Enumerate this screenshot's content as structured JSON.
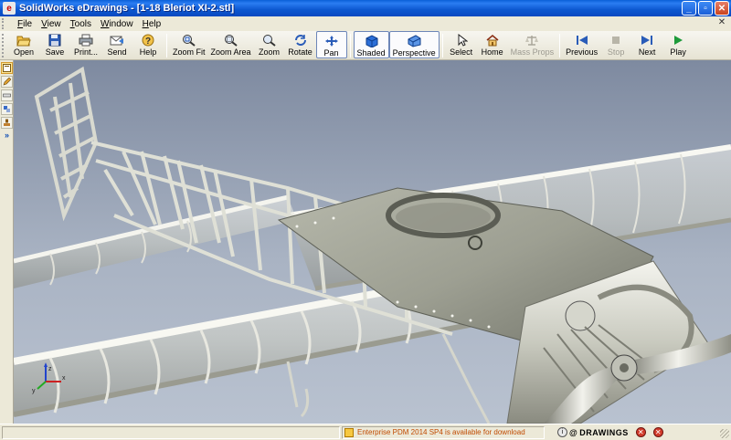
{
  "window": {
    "title": "SolidWorks eDrawings - [1-18 Bleriot XI-2.stl]",
    "app_icon": "edrawings-icon"
  },
  "menu": {
    "items": [
      "File",
      "View",
      "Tools",
      "Window",
      "Help"
    ],
    "underline": [
      "F",
      "V",
      "T",
      "W",
      "H"
    ],
    "rest": [
      "ile",
      "iew",
      "ools",
      "indow",
      "elp"
    ]
  },
  "toolbar": {
    "buttons": [
      {
        "label": "Open",
        "icon": "folder-open-icon"
      },
      {
        "label": "Save",
        "icon": "floppy-disk-icon"
      },
      {
        "label": "Print...",
        "icon": "printer-icon"
      },
      {
        "label": "Send",
        "icon": "send-mail-icon"
      },
      {
        "label": "Help",
        "icon": "help-icon"
      },
      {
        "label": "Zoom Fit",
        "icon": "zoom-fit-icon"
      },
      {
        "label": "Zoom Area",
        "icon": "zoom-area-icon"
      },
      {
        "label": "Zoom",
        "icon": "zoom-icon"
      },
      {
        "label": "Rotate",
        "icon": "rotate-icon"
      },
      {
        "label": "Pan",
        "icon": "pan-icon",
        "active": true
      },
      {
        "label": "Shaded",
        "icon": "shaded-cube-icon"
      },
      {
        "label": "Perspective",
        "icon": "perspective-cube-icon"
      },
      {
        "label": "Select",
        "icon": "cursor-arrow-icon"
      },
      {
        "label": "Home",
        "icon": "home-icon"
      },
      {
        "label": "Mass Props",
        "icon": "scales-icon",
        "disabled": true
      },
      {
        "label": "Previous",
        "icon": "previous-icon"
      },
      {
        "label": "Stop",
        "icon": "stop-icon",
        "disabled": true
      },
      {
        "label": "Next",
        "icon": "next-icon"
      },
      {
        "label": "Play",
        "icon": "play-icon"
      }
    ]
  },
  "left_panel": {
    "buttons": [
      "sheets-icon",
      "markup-pen-icon",
      "measure-icon",
      "components-icon",
      "stamp-icon"
    ],
    "expand": "»"
  },
  "viewport": {
    "model": "1-18 Bleriot XI-2.stl",
    "axes_labels": [
      "x",
      "y",
      "z"
    ]
  },
  "status": {
    "message": "Enterprise PDM 2014 SP4 is available for download",
    "brand": "DRAWINGS",
    "brand_prefix": "@",
    "colors": {
      "warn": "#f7c840",
      "message": "#c04a00"
    }
  }
}
